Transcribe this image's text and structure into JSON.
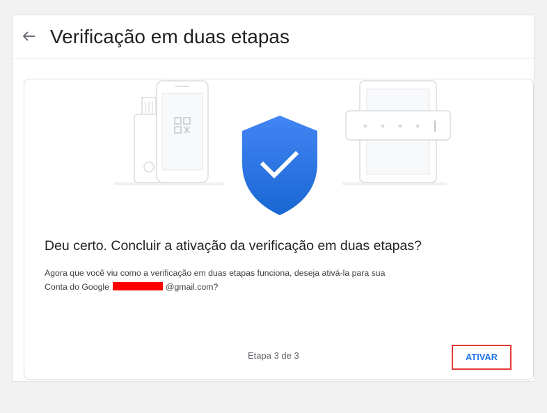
{
  "header": {
    "title": "Verificação em duas etapas",
    "back_icon": "arrow-back-icon"
  },
  "card": {
    "heading": "Deu certo. Concluir a ativação da verificação em duas etapas?",
    "body_line1": "Agora que você viu como a verificação em duas etapas funciona, deseja ativá-la para sua",
    "body_line2_prefix": "Conta do Google",
    "body_line2_suffix": "@gmail.com?",
    "step": "Etapa 3 de 3",
    "activate_label": "ATIVAR"
  },
  "colors": {
    "accent": "#1a73e8",
    "shield_top": "#4285f4",
    "shield_bottom": "#1967d2",
    "highlight_border": "#e53935",
    "redaction": "#ff0000"
  }
}
